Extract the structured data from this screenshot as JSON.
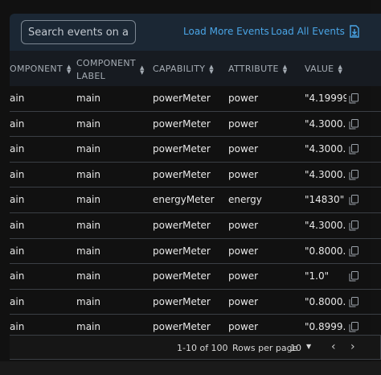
{
  "toolbar": {
    "search_placeholder": "Search events on all",
    "load_more": "Load More Events",
    "load_all": "Load All Events",
    "download_icon": "download-icon"
  },
  "columns": {
    "component": "OMPONENT",
    "label_line1": "COMPONENT",
    "label_line2": "LABEL",
    "capability": "CAPABILITY",
    "attribute": "ATTRIBUTE",
    "value": "VALUE"
  },
  "rows": [
    {
      "component": "ain",
      "label": "main",
      "capability": "powerMeter",
      "attribute": "power",
      "value": "\"4.19999..."
    },
    {
      "component": "ain",
      "label": "main",
      "capability": "powerMeter",
      "attribute": "power",
      "value": "\"4.3000..."
    },
    {
      "component": "ain",
      "label": "main",
      "capability": "powerMeter",
      "attribute": "power",
      "value": "\"4.3000..."
    },
    {
      "component": "ain",
      "label": "main",
      "capability": "powerMeter",
      "attribute": "power",
      "value": "\"4.3000..."
    },
    {
      "component": "ain",
      "label": "main",
      "capability": "energyMeter",
      "attribute": "energy",
      "value": "\"14830\""
    },
    {
      "component": "ain",
      "label": "main",
      "capability": "powerMeter",
      "attribute": "power",
      "value": "\"4.3000..."
    },
    {
      "component": "ain",
      "label": "main",
      "capability": "powerMeter",
      "attribute": "power",
      "value": "\"0.8000..."
    },
    {
      "component": "ain",
      "label": "main",
      "capability": "powerMeter",
      "attribute": "power",
      "value": "\"1.0\""
    },
    {
      "component": "ain",
      "label": "main",
      "capability": "powerMeter",
      "attribute": "power",
      "value": "\"0.8000..."
    },
    {
      "component": "ain",
      "label": "main",
      "capability": "powerMeter",
      "attribute": "power",
      "value": "\"0.8999..."
    }
  ],
  "footer": {
    "range": "1-10 of 100",
    "rows_per_page_label": "Rows per page",
    "rows_per_page_value": "10",
    "prev": "‹",
    "next": "›"
  },
  "colors": {
    "toolbar_bg": "#1b2734",
    "link": "#4aa5e6",
    "page_bg": "#111111"
  }
}
